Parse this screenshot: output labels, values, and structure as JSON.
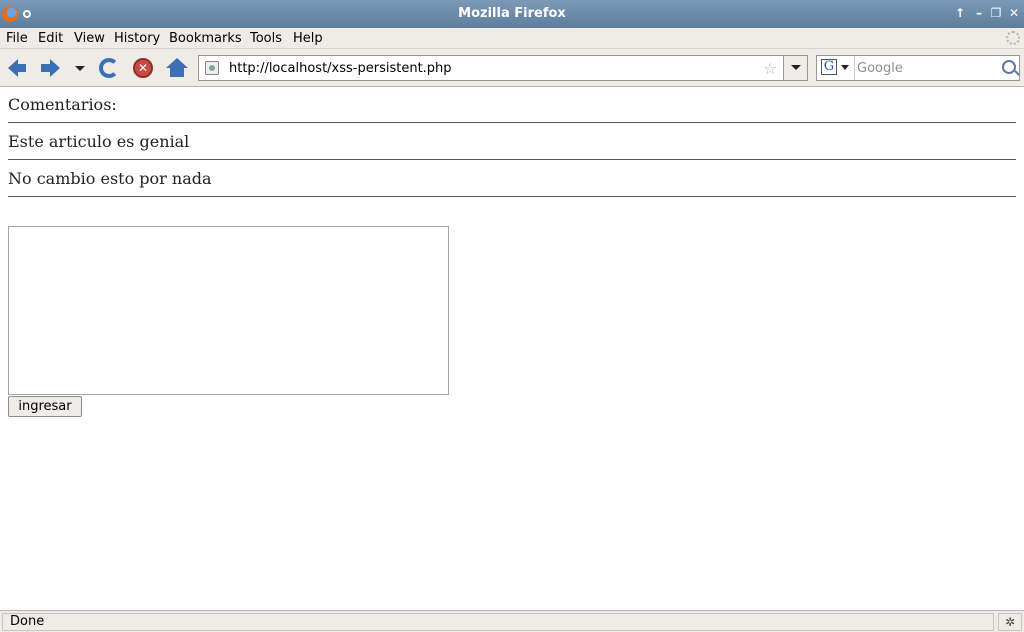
{
  "window": {
    "title": "Mozilla Firefox",
    "controls": [
      "↑",
      "–",
      "❐",
      "✕"
    ]
  },
  "menu": {
    "items": [
      "File",
      "Edit",
      "View",
      "History",
      "Bookmarks",
      "Tools",
      "Help"
    ]
  },
  "toolbar": {
    "url": "http://localhost/xss-persistent.php",
    "star_glyph": "☆",
    "search_placeholder": "Google",
    "engine_letter": "G",
    "stop_glyph": "✕"
  },
  "page": {
    "heading": "Comentarios:",
    "comments": [
      "Este articulo es genial",
      "No cambio esto por nada"
    ],
    "textarea_value": "",
    "submit_label": "ingresar"
  },
  "status": {
    "text": "Done",
    "icon_glyph": "✲"
  },
  "colors": {
    "titlebar": "#6b8bab",
    "chrome": "#efebe7",
    "nav_icon": "#3b6fb6",
    "stop_icon": "#c94a44"
  }
}
